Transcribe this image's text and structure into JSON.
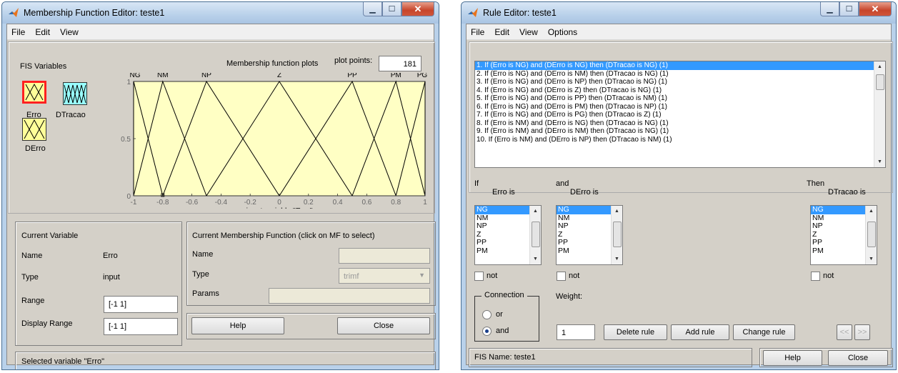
{
  "mf_editor": {
    "title": "Membership Function Editor: teste1",
    "menu": [
      "File",
      "Edit",
      "View"
    ],
    "fis_variables_label": "FIS Variables",
    "variables": [
      {
        "name": "Erro",
        "color": "#ffff99"
      },
      {
        "name": "DTracao",
        "color": "#99ffff"
      },
      {
        "name": "DErro",
        "color": "#ffff99"
      }
    ],
    "plot_title": "Membership function plots",
    "plot_points_label": "plot points:",
    "plot_points_value": "181",
    "plot": {
      "mf_labels": [
        "NG",
        "NM",
        "NP",
        "Z",
        "PP",
        "PM",
        "PG"
      ],
      "x_ticks": [
        "-1",
        "-0.8",
        "-0.6",
        "-0.4",
        "-0.2",
        "0",
        "0.2",
        "0.4",
        "0.6",
        "0.8",
        "1"
      ],
      "y_ticks": [
        "0",
        "0.5",
        "1"
      ],
      "xlabel": "input variable \"Erro\"",
      "bg_color": "#ffffc4"
    },
    "current_variable": {
      "header": "Current Variable",
      "name_label": "Name",
      "name_value": "Erro",
      "type_label": "Type",
      "type_value": "input",
      "range_label": "Range",
      "range_value": "[-1 1]",
      "display_range_label": "Display Range",
      "display_range_value": "[-1 1]"
    },
    "current_mf": {
      "header": "Current Membership Function (click on MF to select)",
      "name_label": "Name",
      "name_value": "",
      "type_label": "Type",
      "type_value": "trimf",
      "params_label": "Params",
      "params_value": ""
    },
    "help_label": "Help",
    "close_label": "Close",
    "status": "Selected variable \"Erro\""
  },
  "rule_editor": {
    "title": "Rule Editor: teste1",
    "menu": [
      "File",
      "Edit",
      "View",
      "Options"
    ],
    "rules": [
      "1. If (Erro is NG) and (DErro is NG) then (DTracao is NG) (1)",
      "2. If (Erro is NG) and (DErro is NM) then (DTracao is NG) (1)",
      "3. If (Erro is NG) and (DErro is NP) then (DTracao is NG) (1)",
      "4. If (Erro is NG) and (DErro is Z) then (DTracao is NG) (1)",
      "5. If (Erro is NG) and (DErro is PP) then (DTracao is NM) (1)",
      "6. If (Erro is NG) and (DErro is PM) then (DTracao is NP) (1)",
      "7. If (Erro is NG) and (DErro is PG) then (DTracao is Z) (1)",
      "8. If (Erro is NM) and (DErro is NG) then (DTracao is NG) (1)",
      "9. If (Erro is NM) and (DErro is NM) then (DTracao is NG) (1)",
      "10. If (Erro is NM) and (DErro is NP) then (DTracao is NM) (1)"
    ],
    "if_label": "If",
    "and_label": "and",
    "then_label": "Then",
    "erro_is_label": "Erro is",
    "derro_is_label": "DErro is",
    "dtracao_is_label": "DTracao is",
    "options": [
      "NG",
      "NM",
      "NP",
      "Z",
      "PP",
      "PM"
    ],
    "not_label": "not",
    "connection_label": "Connection",
    "or_label": "or",
    "and_radio_label": "and",
    "weight_label": "Weight:",
    "weight_value": "1",
    "delete_rule_label": "Delete rule",
    "add_rule_label": "Add rule",
    "change_rule_label": "Change rule",
    "prev_label": "<<",
    "next_label": ">>",
    "fis_name": "FIS Name: teste1",
    "help_label": "Help",
    "close_label": "Close"
  }
}
